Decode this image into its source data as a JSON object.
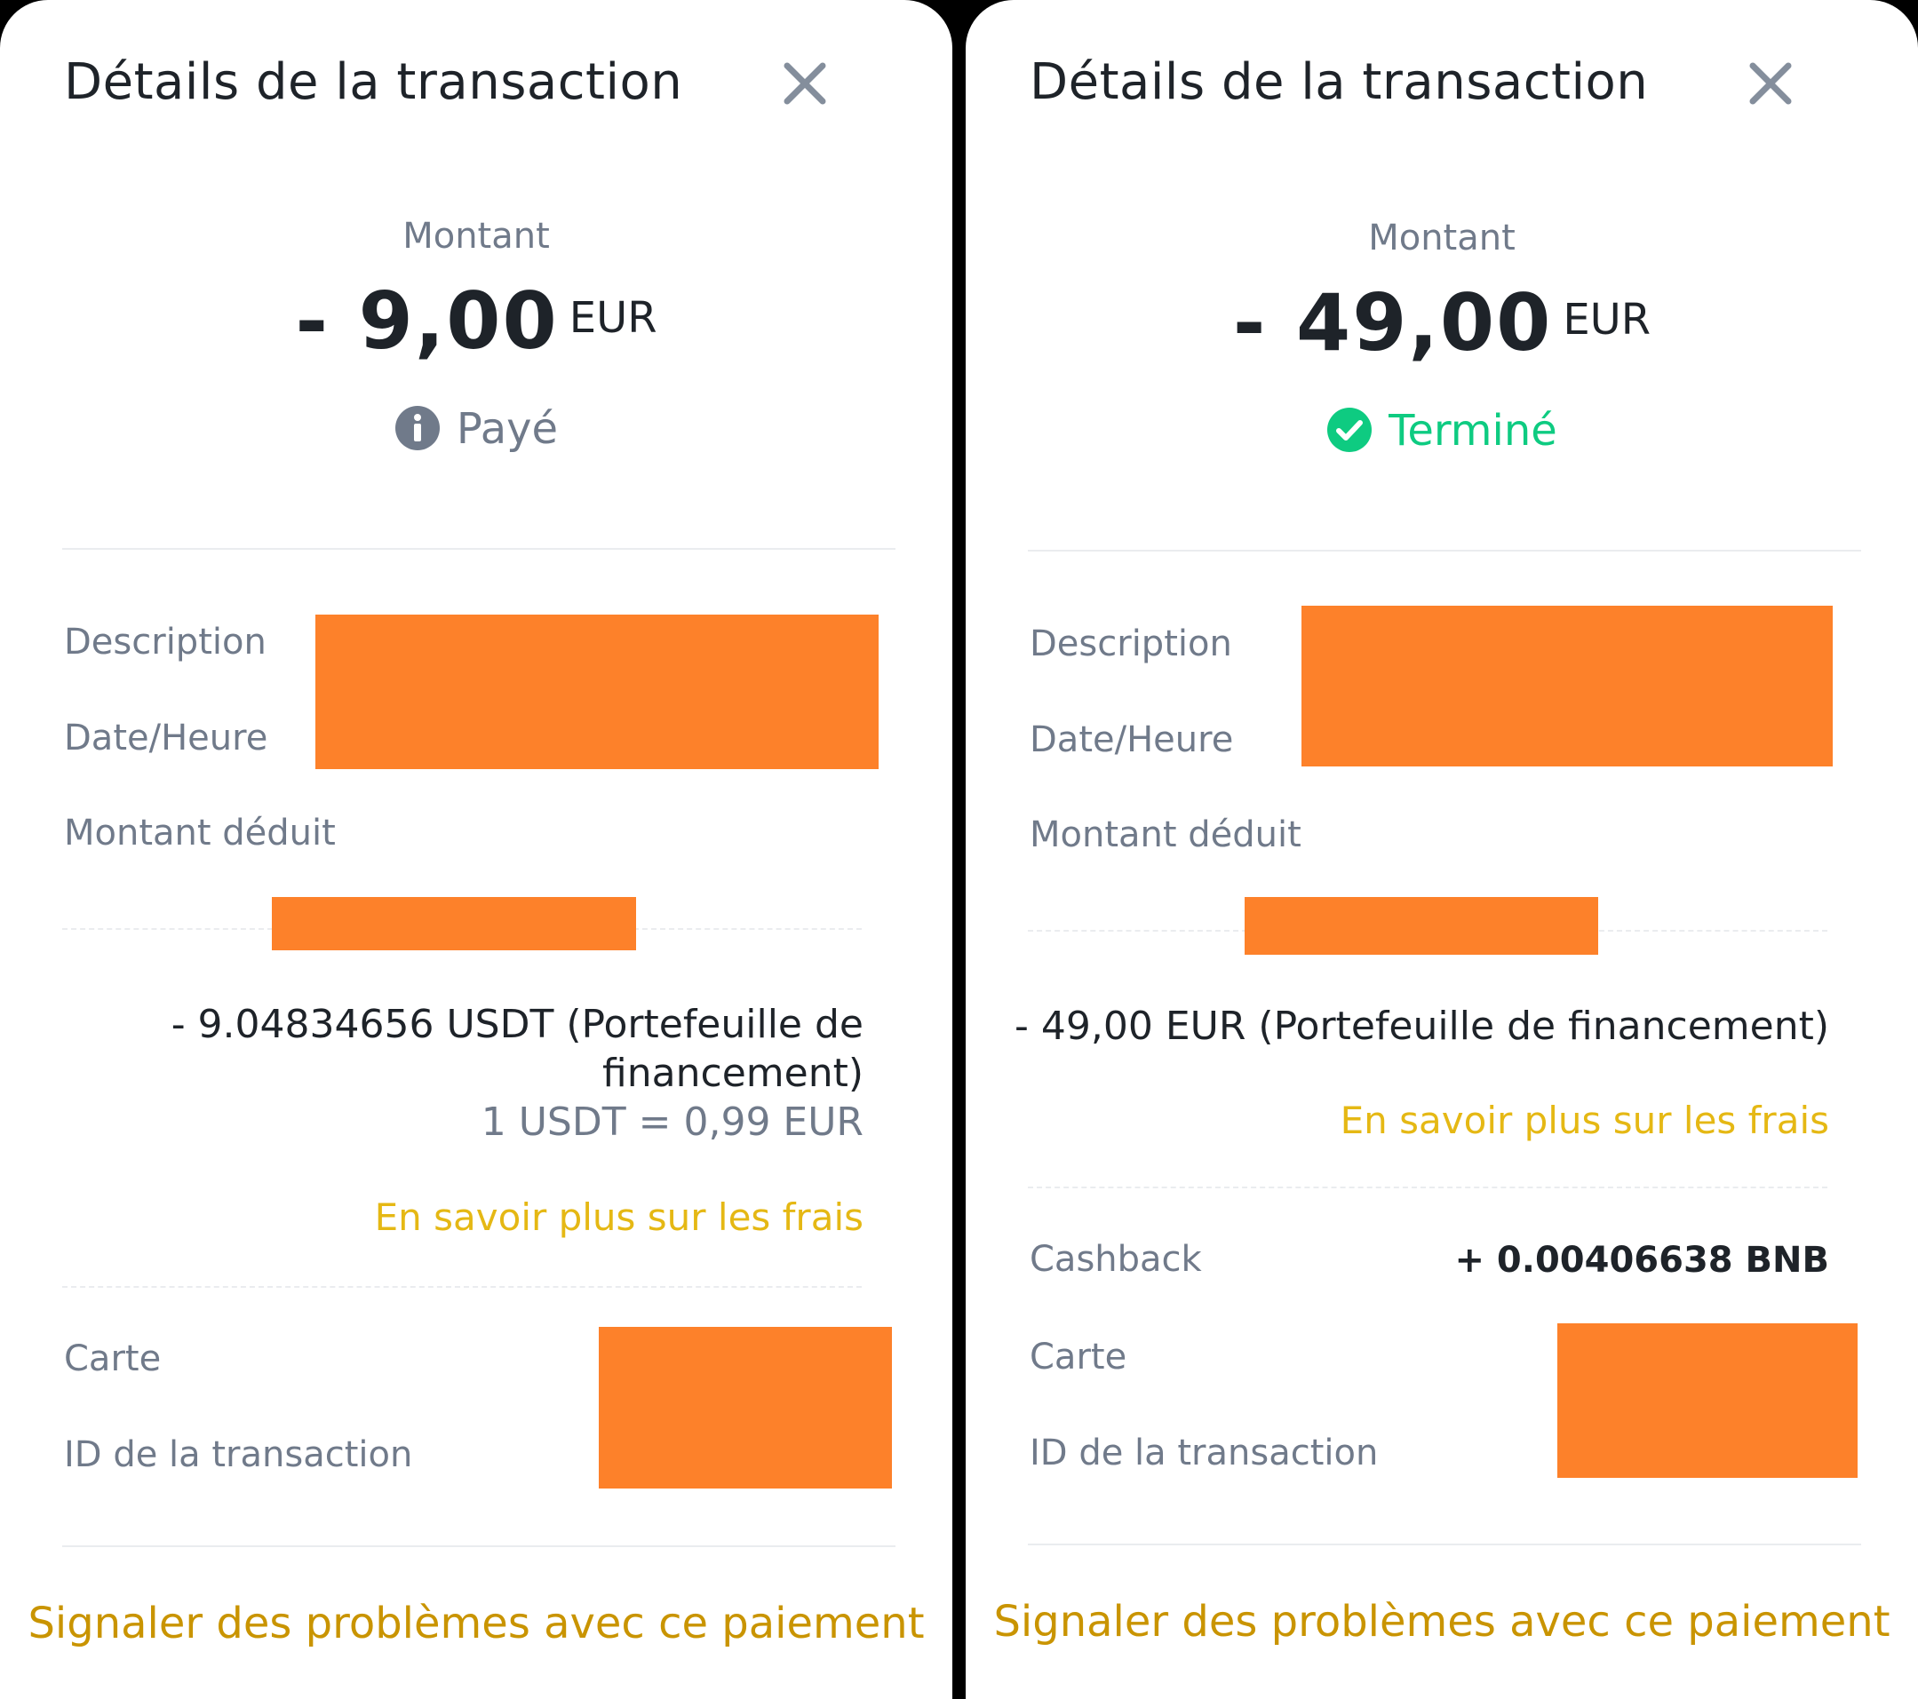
{
  "left": {
    "title": "Détails de la transaction",
    "amount_label": "Montant",
    "amount_value": "- 9,00",
    "amount_currency": "EUR",
    "status_text": "Payé",
    "status_color": "#707a8a",
    "status_icon": "info-icon",
    "fields": {
      "description": "Description",
      "datetime": "Date/Heure",
      "deducted": "Montant déduit",
      "card": "Carte",
      "transaction_id": "ID de la transaction"
    },
    "deducted_line1": "- 9.04834656 USDT (Portefeuille de",
    "deducted_line2": "financement)",
    "rate": "1 USDT = 0,99 EUR",
    "fees_link": "En savoir plus sur les frais",
    "report_link": "Signaler des problèmes avec ce paiement"
  },
  "right": {
    "title": "Détails de la transaction",
    "amount_label": "Montant",
    "amount_value": "- 49,00",
    "amount_currency": "EUR",
    "status_text": "Terminé",
    "status_color": "#0ecb81",
    "status_icon": "check-circle-icon",
    "fields": {
      "description": "Description",
      "datetime": "Date/Heure",
      "deducted": "Montant déduit",
      "cashback": "Cashback",
      "card": "Carte",
      "transaction_id": "ID de la transaction"
    },
    "deducted_line1": "- 49,00 EUR (Portefeuille de financement)",
    "cashback_value": "+ 0.00406638 BNB",
    "fees_link": "En savoir plus sur les frais",
    "report_link": "Signaler des problèmes avec ce paiement"
  },
  "colors": {
    "redaction": "#fd812a",
    "link_yellow": "#e5b814",
    "report_gold": "#c99400",
    "text_primary": "#1e2329",
    "text_secondary": "#707a8a"
  }
}
